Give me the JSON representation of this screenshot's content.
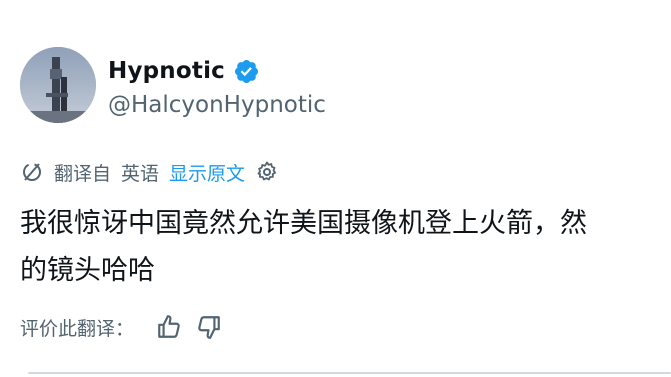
{
  "author": {
    "display_name": "Hypnotic",
    "handle": "@HalcyonHypnotic",
    "verified": true,
    "verified_color": "#1d9bf0"
  },
  "translation": {
    "translated_from": "翻译自",
    "source_language": "英语",
    "show_original_label": "显示原文",
    "icons": [
      "translate-icon",
      "gear-icon"
    ]
  },
  "tweet": {
    "text_lines": [
      "我很惊讶中国竟然允许美国摄像机登上火箭，然",
      "的镜头哈哈"
    ]
  },
  "rating": {
    "label": "评价此翻译：",
    "icons": [
      "thumbs-up-icon",
      "thumbs-down-icon"
    ]
  },
  "colors": {
    "text_primary": "#0f1419",
    "text_secondary": "#536471",
    "link": "#1d9bf0"
  }
}
